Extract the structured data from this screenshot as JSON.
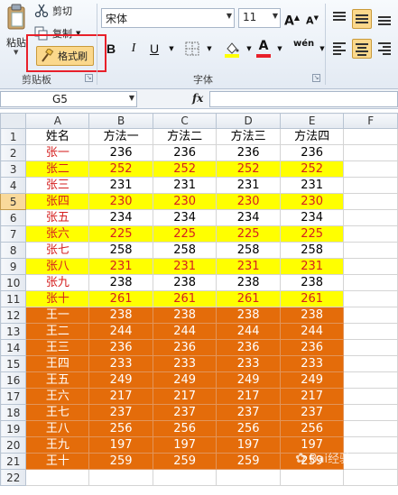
{
  "ribbon": {
    "clipboard": {
      "paste_label": "粘贴",
      "cut_label": "剪切",
      "copy_label": "复制",
      "format_painter_label": "格式刷",
      "group_label": "剪贴板"
    },
    "font": {
      "font_name": "宋体",
      "font_size": "11",
      "bold_label": "B",
      "italic_label": "I",
      "underline_label": "U",
      "grow_label": "A",
      "shrink_label": "A",
      "color_label": "A",
      "phonetic_label": "wén",
      "group_label": "字体"
    }
  },
  "formula_bar": {
    "cell_ref": "G5",
    "fx_label": "fx",
    "formula": ""
  },
  "sheet": {
    "columns": [
      "A",
      "B",
      "C",
      "D",
      "E",
      "F"
    ],
    "header_row": [
      "姓名",
      "方法一",
      "方法二",
      "方法三",
      "方法四"
    ],
    "rows": [
      {
        "num": "2",
        "style": "white",
        "cells": [
          "张一",
          "236",
          "236",
          "236",
          "236"
        ]
      },
      {
        "num": "3",
        "style": "yellow",
        "cells": [
          "张二",
          "252",
          "252",
          "252",
          "252"
        ]
      },
      {
        "num": "4",
        "style": "white",
        "cells": [
          "张三",
          "231",
          "231",
          "231",
          "231"
        ]
      },
      {
        "num": "5",
        "style": "yellow",
        "cells": [
          "张四",
          "230",
          "230",
          "230",
          "230"
        ]
      },
      {
        "num": "6",
        "style": "white",
        "cells": [
          "张五",
          "234",
          "234",
          "234",
          "234"
        ]
      },
      {
        "num": "7",
        "style": "yellow",
        "cells": [
          "张六",
          "225",
          "225",
          "225",
          "225"
        ]
      },
      {
        "num": "8",
        "style": "white",
        "cells": [
          "张七",
          "258",
          "258",
          "258",
          "258"
        ]
      },
      {
        "num": "9",
        "style": "yellow",
        "cells": [
          "张八",
          "231",
          "231",
          "231",
          "231"
        ]
      },
      {
        "num": "10",
        "style": "white",
        "cells": [
          "张九",
          "238",
          "238",
          "238",
          "238"
        ]
      },
      {
        "num": "11",
        "style": "yellow",
        "cells": [
          "张十",
          "261",
          "261",
          "261",
          "261"
        ]
      },
      {
        "num": "12",
        "style": "orange",
        "cells": [
          "王一",
          "238",
          "238",
          "238",
          "238"
        ]
      },
      {
        "num": "13",
        "style": "orange",
        "cells": [
          "王二",
          "244",
          "244",
          "244",
          "244"
        ]
      },
      {
        "num": "14",
        "style": "orange",
        "cells": [
          "王三",
          "236",
          "236",
          "236",
          "236"
        ]
      },
      {
        "num": "15",
        "style": "orange",
        "cells": [
          "王四",
          "233",
          "233",
          "233",
          "233"
        ]
      },
      {
        "num": "16",
        "style": "orange",
        "cells": [
          "王五",
          "249",
          "249",
          "249",
          "249"
        ]
      },
      {
        "num": "17",
        "style": "orange",
        "cells": [
          "王六",
          "217",
          "217",
          "217",
          "217"
        ]
      },
      {
        "num": "18",
        "style": "orange",
        "cells": [
          "王七",
          "237",
          "237",
          "237",
          "237"
        ]
      },
      {
        "num": "19",
        "style": "orange",
        "cells": [
          "王八",
          "256",
          "256",
          "256",
          "256"
        ]
      },
      {
        "num": "20",
        "style": "orange",
        "cells": [
          "王九",
          "197",
          "197",
          "197",
          "197"
        ]
      },
      {
        "num": "21",
        "style": "orange",
        "cells": [
          "王十",
          "259",
          "259",
          "259",
          "259"
        ]
      }
    ],
    "empty_row_num": "22",
    "header_row_num": "1",
    "selected_row": "5"
  },
  "watermark": {
    "text": "Bai经验"
  },
  "colors": {
    "highlight_yellow": "#ffff00",
    "red_text": "#d52020",
    "orange_fill": "#e46c0a",
    "callout_red": "#e8202a"
  },
  "icons": [
    "paste-icon",
    "scissors-icon",
    "copy-icon",
    "paintbrush-icon",
    "border-icon",
    "fill-color-icon",
    "align-left-icon",
    "align-center-icon",
    "align-right-icon",
    "align-top-icon",
    "align-middle-icon"
  ]
}
